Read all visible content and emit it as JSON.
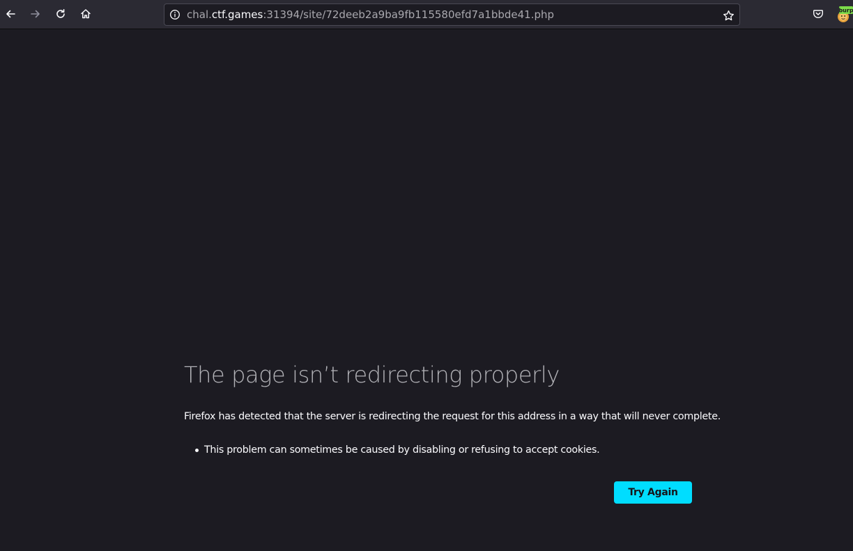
{
  "browser": {
    "url": {
      "scheme_host_prefix": "chal.",
      "host_main": "ctf.games",
      "rest": ":31394/site/72deeb2a9ba9fb115580efd7a1bbde41.php"
    },
    "extensions": {
      "burp_label": "burp"
    },
    "colors": {
      "toolbar_bg": "#2b2a33",
      "page_bg": "#1c1b22",
      "accent": "#00ddff"
    },
    "icons": [
      "back-icon",
      "forward-icon",
      "reload-icon",
      "home-icon",
      "site-info-icon",
      "bookmark-star-icon",
      "pocket-icon",
      "burp-extension-icon"
    ]
  },
  "error_page": {
    "title": "The page isn’t redirecting properly",
    "description": "Firefox has detected that the server is redirecting the request for this address in a way that will never complete.",
    "causes": [
      "This problem can sometimes be caused by disabling or refusing to accept cookies."
    ],
    "try_again_label": "Try Again"
  }
}
